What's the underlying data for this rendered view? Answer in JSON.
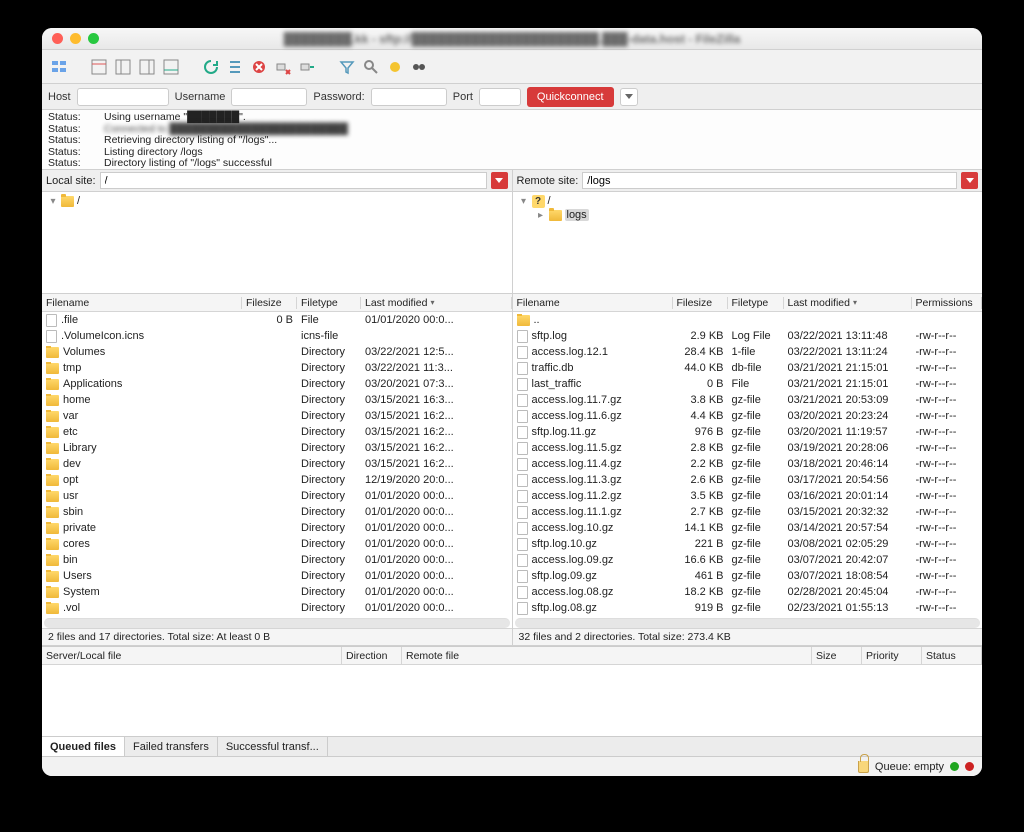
{
  "window": {
    "title": "████████.kk - sftp://██████████████████████.███-data.host - FileZilla"
  },
  "conn": {
    "host_label": "Host",
    "username_label": "Username",
    "password_label": "Password:",
    "port_label": "Port",
    "quickconnect": "Quickconnect",
    "host": "",
    "username": "",
    "password": "",
    "port": ""
  },
  "status": [
    {
      "label": "Status:",
      "msg": "Using username \"███████\"."
    },
    {
      "label": "Status:",
      "msg": "Connected to ████████████████████████"
    },
    {
      "label": "Status:",
      "msg": "Retrieving directory listing of \"/logs\"..."
    },
    {
      "label": "Status:",
      "msg": "Listing directory /logs"
    },
    {
      "label": "Status:",
      "msg": "Directory listing of \"/logs\" successful"
    }
  ],
  "local": {
    "label": "Local site:",
    "path": "/",
    "tree": [
      {
        "depth": 0,
        "chev": "▾",
        "kind": "folder",
        "name": "/"
      }
    ],
    "cols": {
      "name": "Filename",
      "size": "Filesize",
      "type": "Filetype",
      "mod": "Last modified"
    },
    "files": [
      {
        "icon": "file",
        "name": ".file",
        "size": "0 B",
        "type": "File",
        "mod": "01/01/2020 00:0..."
      },
      {
        "icon": "file",
        "name": ".VolumeIcon.icns",
        "size": "",
        "type": "icns-file",
        "mod": ""
      },
      {
        "icon": "folder",
        "name": "Volumes",
        "size": "",
        "type": "Directory",
        "mod": "03/22/2021 12:5..."
      },
      {
        "icon": "folder",
        "name": "tmp",
        "size": "",
        "type": "Directory",
        "mod": "03/22/2021 11:3..."
      },
      {
        "icon": "folder",
        "name": "Applications",
        "size": "",
        "type": "Directory",
        "mod": "03/20/2021 07:3..."
      },
      {
        "icon": "folder",
        "name": "home",
        "size": "",
        "type": "Directory",
        "mod": "03/15/2021 16:3..."
      },
      {
        "icon": "folder",
        "name": "var",
        "size": "",
        "type": "Directory",
        "mod": "03/15/2021 16:2..."
      },
      {
        "icon": "folder",
        "name": "etc",
        "size": "",
        "type": "Directory",
        "mod": "03/15/2021 16:2..."
      },
      {
        "icon": "folder",
        "name": "Library",
        "size": "",
        "type": "Directory",
        "mod": "03/15/2021 16:2..."
      },
      {
        "icon": "folder",
        "name": "dev",
        "size": "",
        "type": "Directory",
        "mod": "03/15/2021 16:2..."
      },
      {
        "icon": "folder",
        "name": "opt",
        "size": "",
        "type": "Directory",
        "mod": "12/19/2020 20:0..."
      },
      {
        "icon": "folder",
        "name": "usr",
        "size": "",
        "type": "Directory",
        "mod": "01/01/2020 00:0..."
      },
      {
        "icon": "folder",
        "name": "sbin",
        "size": "",
        "type": "Directory",
        "mod": "01/01/2020 00:0..."
      },
      {
        "icon": "folder",
        "name": "private",
        "size": "",
        "type": "Directory",
        "mod": "01/01/2020 00:0..."
      },
      {
        "icon": "folder",
        "name": "cores",
        "size": "",
        "type": "Directory",
        "mod": "01/01/2020 00:0..."
      },
      {
        "icon": "folder",
        "name": "bin",
        "size": "",
        "type": "Directory",
        "mod": "01/01/2020 00:0..."
      },
      {
        "icon": "folder",
        "name": "Users",
        "size": "",
        "type": "Directory",
        "mod": "01/01/2020 00:0..."
      },
      {
        "icon": "folder",
        "name": "System",
        "size": "",
        "type": "Directory",
        "mod": "01/01/2020 00:0..."
      },
      {
        "icon": "folder",
        "name": ".vol",
        "size": "",
        "type": "Directory",
        "mod": "01/01/2020 00:0..."
      }
    ],
    "summary": "2 files and 17 directories. Total size: At least 0 B"
  },
  "remote": {
    "label": "Remote site:",
    "path": "/logs",
    "tree": [
      {
        "depth": 0,
        "chev": "▾",
        "kind": "q",
        "name": "/"
      },
      {
        "depth": 1,
        "chev": "▸",
        "kind": "folder",
        "name": "logs",
        "sel": true
      }
    ],
    "cols": {
      "name": "Filename",
      "size": "Filesize",
      "type": "Filetype",
      "mod": "Last modified",
      "perm": "Permissions"
    },
    "files": [
      {
        "icon": "folder",
        "name": "..",
        "size": "",
        "type": "",
        "mod": "",
        "perm": ""
      },
      {
        "icon": "file",
        "name": "sftp.log",
        "size": "2.9 KB",
        "type": "Log File",
        "mod": "03/22/2021 13:11:48",
        "perm": "-rw-r--r--"
      },
      {
        "icon": "file",
        "name": "access.log.12.1",
        "size": "28.4 KB",
        "type": "1-file",
        "mod": "03/22/2021 13:11:24",
        "perm": "-rw-r--r--"
      },
      {
        "icon": "file",
        "name": "traffic.db",
        "size": "44.0 KB",
        "type": "db-file",
        "mod": "03/21/2021 21:15:01",
        "perm": "-rw-r--r--"
      },
      {
        "icon": "file",
        "name": "last_traffic",
        "size": "0 B",
        "type": "File",
        "mod": "03/21/2021 21:15:01",
        "perm": "-rw-r--r--"
      },
      {
        "icon": "file",
        "name": "access.log.11.7.gz",
        "size": "3.8 KB",
        "type": "gz-file",
        "mod": "03/21/2021 20:53:09",
        "perm": "-rw-r--r--"
      },
      {
        "icon": "file",
        "name": "access.log.11.6.gz",
        "size": "4.4 KB",
        "type": "gz-file",
        "mod": "03/20/2021 20:23:24",
        "perm": "-rw-r--r--"
      },
      {
        "icon": "file",
        "name": "sftp.log.11.gz",
        "size": "976 B",
        "type": "gz-file",
        "mod": "03/20/2021 11:19:57",
        "perm": "-rw-r--r--"
      },
      {
        "icon": "file",
        "name": "access.log.11.5.gz",
        "size": "2.8 KB",
        "type": "gz-file",
        "mod": "03/19/2021 20:28:06",
        "perm": "-rw-r--r--"
      },
      {
        "icon": "file",
        "name": "access.log.11.4.gz",
        "size": "2.2 KB",
        "type": "gz-file",
        "mod": "03/18/2021 20:46:14",
        "perm": "-rw-r--r--"
      },
      {
        "icon": "file",
        "name": "access.log.11.3.gz",
        "size": "2.6 KB",
        "type": "gz-file",
        "mod": "03/17/2021 20:54:56",
        "perm": "-rw-r--r--"
      },
      {
        "icon": "file",
        "name": "access.log.11.2.gz",
        "size": "3.5 KB",
        "type": "gz-file",
        "mod": "03/16/2021 20:01:14",
        "perm": "-rw-r--r--"
      },
      {
        "icon": "file",
        "name": "access.log.11.1.gz",
        "size": "2.7 KB",
        "type": "gz-file",
        "mod": "03/15/2021 20:32:32",
        "perm": "-rw-r--r--"
      },
      {
        "icon": "file",
        "name": "access.log.10.gz",
        "size": "14.1 KB",
        "type": "gz-file",
        "mod": "03/14/2021 20:57:54",
        "perm": "-rw-r--r--"
      },
      {
        "icon": "file",
        "name": "sftp.log.10.gz",
        "size": "221 B",
        "type": "gz-file",
        "mod": "03/08/2021 02:05:29",
        "perm": "-rw-r--r--"
      },
      {
        "icon": "file",
        "name": "access.log.09.gz",
        "size": "16.6 KB",
        "type": "gz-file",
        "mod": "03/07/2021 20:42:07",
        "perm": "-rw-r--r--"
      },
      {
        "icon": "file",
        "name": "sftp.log.09.gz",
        "size": "461 B",
        "type": "gz-file",
        "mod": "03/07/2021 18:08:54",
        "perm": "-rw-r--r--"
      },
      {
        "icon": "file",
        "name": "access.log.08.gz",
        "size": "18.2 KB",
        "type": "gz-file",
        "mod": "02/28/2021 20:45:04",
        "perm": "-rw-r--r--"
      },
      {
        "icon": "file",
        "name": "sftp.log.08.gz",
        "size": "919 B",
        "type": "gz-file",
        "mod": "02/23/2021 01:55:13",
        "perm": "-rw-r--r--"
      }
    ],
    "summary": "32 files and 2 directories. Total size: 273.4 KB"
  },
  "queue": {
    "cols": {
      "local": "Server/Local file",
      "dir": "Direction",
      "remote": "Remote file",
      "size": "Size",
      "prio": "Priority",
      "status": "Status"
    },
    "tabs": {
      "queued": "Queued files",
      "failed": "Failed transfers",
      "success": "Successful transf..."
    }
  },
  "statusbar": {
    "queue": "Queue: empty"
  }
}
